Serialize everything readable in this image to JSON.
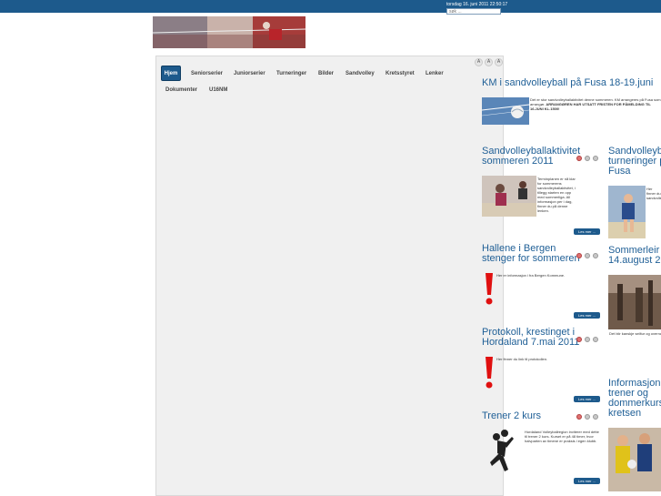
{
  "header": {
    "datetime": "torsdag 16. juni 2011 22:50:17",
    "search_placeholder": "søk ..."
  },
  "font_size_buttons": [
    "A",
    "A",
    "A"
  ],
  "nav": {
    "row1": [
      "Hjem",
      "Seniorserier",
      "Juniorserier",
      "Turneringer",
      "Bilder",
      "Sandvolley",
      "Kretsstyret",
      "Lenker"
    ],
    "row2": [
      "Dokumenter",
      "U16NM"
    ]
  },
  "featured": {
    "title": "KM i sandvolleyball på Fusa 18-19.juni",
    "text_plain": "Det er stor sandvolleyballaktivitet denne sommeren. KM arrangeres på Fusa som arrangør.",
    "text_bold": "ARRANGØREN HAR UTSATT FRISTEN FOR PÅMELDING TIL 16.JUNI KL.1500!"
  },
  "articles": [
    {
      "title_lines": [
        "Sandvolleyballaktivitet",
        "sommeren 2011"
      ],
      "text": "Terminplanen er nå klar for sommerens sandvolleyballaktivitet, i tillegg starten en opp med sommerliga. All informasjon per i dag, finner du på denne lenken.",
      "read_more": "Les mer ..."
    },
    {
      "title_lines": [
        "Hallene i Bergen",
        "stenger for sommeren"
      ],
      "text": "Her er informasjon i fra Bergen Kommune.",
      "read_more": "Les mer ..."
    },
    {
      "title_lines": [
        "Protokoll, krestinget i",
        "Hordaland 7.mai 2011"
      ],
      "text": "Her finner du link til protokollen.",
      "read_more": "Les mer ..."
    },
    {
      "title_lines": [
        "Trener 2 kurs"
      ],
      "text": "Hordaland Volleyballregion inviterer med dette til trener 2 kurs. Kurset er på 48 timer, hvor halvparten av timene er praksis i egen klubb.",
      "read_more": "Les mer ..."
    }
  ],
  "right_column": [
    {
      "title_lines": [
        "Sandvolleyba",
        "turneringer p",
        "Fusa"
      ],
      "text": "Her finner du sandvolleyballturneringene..."
    },
    {
      "title_lines": [
        "Sommerleir",
        "14.august 20"
      ],
      "text": "Det blir kanskje seiltur og overnatting"
    },
    {
      "title_lines": [
        "Informasjon",
        "trener og",
        "dommerkurs",
        "kretsen"
      ],
      "text": ""
    }
  ]
}
